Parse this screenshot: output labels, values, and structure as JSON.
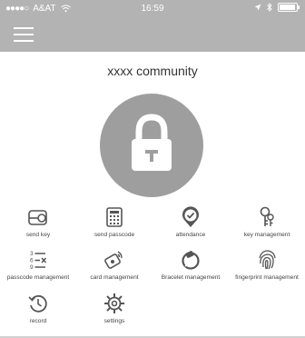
{
  "status": {
    "signal_dots": "●●●●○",
    "carrier": "A&AT",
    "time": "16:59",
    "wifi_icon": "wifi-icon",
    "location_icon": "location-arrow-icon",
    "bluetooth_icon": "bluetooth-icon",
    "battery_icon": "battery-icon"
  },
  "header": {
    "menu_icon": "hamburger-menu-icon"
  },
  "community": {
    "title": "xxxx community",
    "lock_icon": "lock-icon"
  },
  "colors": {
    "topbar": "#b3b3b3",
    "lock_circle": "#9e9e9e",
    "icon_stroke": "#555555"
  },
  "actions": [
    {
      "label": "send key",
      "icon": "send-key-icon"
    },
    {
      "label": "send passcode",
      "icon": "keypad-icon"
    },
    {
      "label": "attendance",
      "icon": "check-badge-icon"
    },
    {
      "label": "key management",
      "icon": "keys-icon"
    },
    {
      "label": "passcode management",
      "icon": "numbered-list-icon"
    },
    {
      "label": "card management",
      "icon": "nfc-card-icon"
    },
    {
      "label": "Bracelet management",
      "icon": "bracelet-icon"
    },
    {
      "label": "fingerprint management",
      "icon": "fingerprint-icon"
    },
    {
      "label": "record",
      "icon": "history-icon"
    },
    {
      "label": "settings",
      "icon": "settings-gear-icon"
    }
  ]
}
